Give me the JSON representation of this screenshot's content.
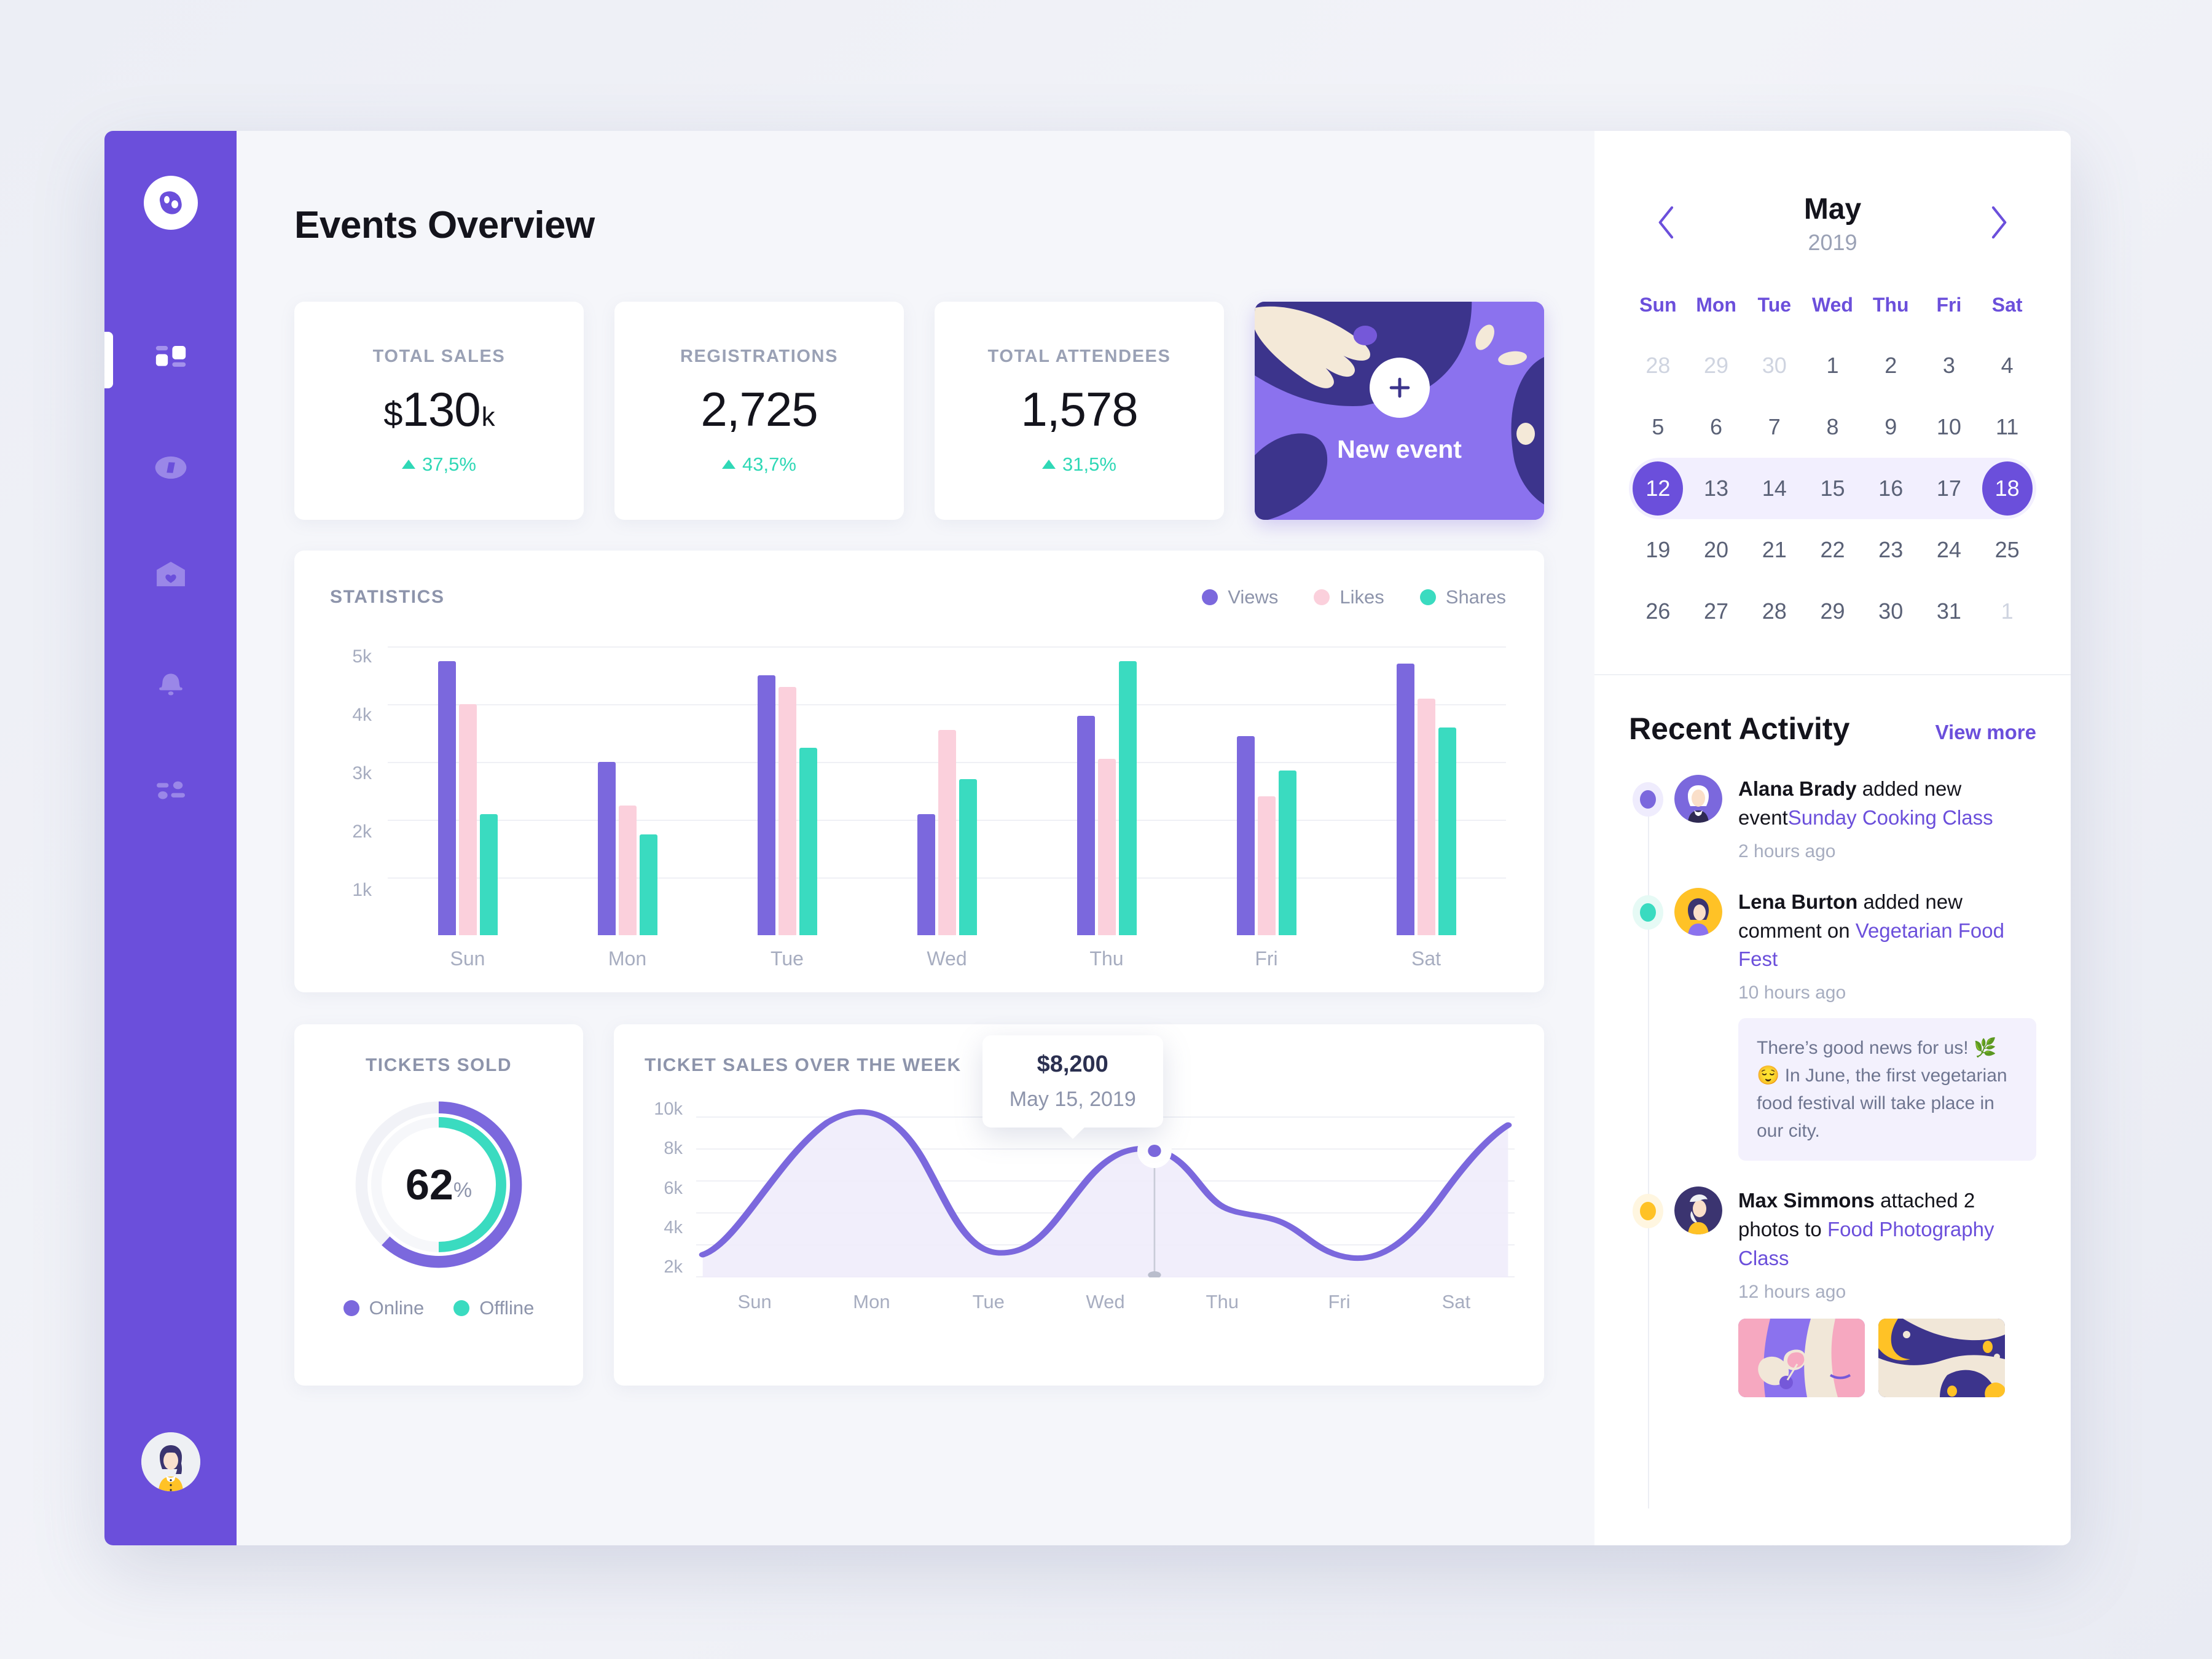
{
  "app": {
    "title": "Events Overview"
  },
  "sidebar": {
    "logo_name": "app-logo",
    "items": [
      {
        "icon": "dashboard-grid-icon",
        "active": true
      },
      {
        "icon": "compass-icon",
        "active": false
      },
      {
        "icon": "mail-heart-icon",
        "active": false
      },
      {
        "icon": "bell-icon",
        "active": false
      },
      {
        "icon": "sliders-settings-icon",
        "active": false
      }
    ],
    "avatar_name": "user-avatar"
  },
  "stats": [
    {
      "label": "TOTAL SALES",
      "currency": "$",
      "value": "130",
      "suffix": "k",
      "delta": "37,5%",
      "trend": "up"
    },
    {
      "label": "REGISTRATIONS",
      "currency": "",
      "value": "2,725",
      "suffix": "",
      "delta": "43,7%",
      "trend": "up"
    },
    {
      "label": "TOTAL ATTENDEES",
      "currency": "",
      "value": "1,578",
      "suffix": "",
      "delta": "31,5%",
      "trend": "up"
    }
  ],
  "new_event": {
    "label": "New event",
    "plus_icon": "plus-icon"
  },
  "statistics_panel": {
    "title": "STATISTICS"
  },
  "tickets_card": {
    "title": "TICKETS SOLD",
    "percent": "62",
    "percent_symbol": "%",
    "legend": [
      {
        "label": "Online",
        "color": "#7B68DD"
      },
      {
        "label": "Offline",
        "color": "#3ADBC0"
      }
    ]
  },
  "line_card": {
    "title": "TICKET SALES OVER THE WEEK",
    "tooltip": {
      "value": "$8,200",
      "date": "May 15, 2019"
    }
  },
  "calendar": {
    "month": "May",
    "year": "2019",
    "prev_icon": "chevron-left-icon",
    "next_icon": "chevron-right-icon",
    "dow": [
      "Sun",
      "Mon",
      "Tue",
      "Wed",
      "Thu",
      "Fri",
      "Sat"
    ],
    "weeks": [
      [
        {
          "d": "28",
          "m": true
        },
        {
          "d": "29",
          "m": true
        },
        {
          "d": "30",
          "m": true
        },
        {
          "d": "1"
        },
        {
          "d": "2"
        },
        {
          "d": "3"
        },
        {
          "d": "4"
        }
      ],
      [
        {
          "d": "5"
        },
        {
          "d": "6"
        },
        {
          "d": "7"
        },
        {
          "d": "8"
        },
        {
          "d": "9"
        },
        {
          "d": "10"
        },
        {
          "d": "11"
        }
      ],
      [
        {
          "d": "12",
          "sel": true,
          "rs": true
        },
        {
          "d": "13",
          "ir": true
        },
        {
          "d": "14",
          "ir": true
        },
        {
          "d": "15",
          "ir": true
        },
        {
          "d": "16",
          "ir": true
        },
        {
          "d": "17",
          "ir": true
        },
        {
          "d": "18",
          "sel": true,
          "re": true
        }
      ],
      [
        {
          "d": "19"
        },
        {
          "d": "20"
        },
        {
          "d": "21"
        },
        {
          "d": "22"
        },
        {
          "d": "23"
        },
        {
          "d": "24"
        },
        {
          "d": "25"
        }
      ],
      [
        {
          "d": "26"
        },
        {
          "d": "27"
        },
        {
          "d": "28"
        },
        {
          "d": "29"
        },
        {
          "d": "30"
        },
        {
          "d": "31"
        },
        {
          "d": "1",
          "m": true
        }
      ]
    ]
  },
  "recent_activity": {
    "title": "Recent Activity",
    "view_more": "View more",
    "items": [
      {
        "dot_color": "#7B68DD",
        "dot_bg": "#efecfd",
        "avatar": "avatar-alana-brady",
        "name": "Alana Brady",
        "action": " added new event",
        "link": "Sunday Cooking Class",
        "time": "2 hours ago"
      },
      {
        "dot_color": "#3ADBC0",
        "dot_bg": "#e6faf5",
        "avatar": "avatar-lena-burton",
        "name": "Lena Burton",
        "action": " added new comment on ",
        "link": "Vegetarian Food Fest",
        "time": "10 hours ago",
        "bubble": "There’s good news for us! 🌿😌 In June, the first vegetarian food festival will take place in our city."
      },
      {
        "dot_color": "#FFC226",
        "dot_bg": "#fff6e0",
        "avatar": "avatar-max-simmons",
        "name": "Max Simmons",
        "action": " attached 2 photos to ",
        "link": "Food Photography Class",
        "time": "12 hours ago",
        "photos": [
          "photo-wine-glass",
          "photo-abstract-navy"
        ]
      }
    ]
  },
  "chart_data": [
    {
      "type": "bar",
      "title": "STATISTICS",
      "categories": [
        "Sun",
        "Mon",
        "Tue",
        "Wed",
        "Thu",
        "Fri",
        "Sat"
      ],
      "series": [
        {
          "name": "Views",
          "color": "#7B68DD",
          "values": [
            4750,
            3000,
            4500,
            2100,
            3800,
            3450,
            4700
          ]
        },
        {
          "name": "Likes",
          "color": "#FBD0DC",
          "values": [
            4000,
            2250,
            4300,
            3550,
            3050,
            2400,
            4100
          ]
        },
        {
          "name": "Shares",
          "color": "#3ADBC0",
          "values": [
            2100,
            1750,
            3250,
            2700,
            4750,
            2850,
            3600
          ]
        }
      ],
      "ylim": [
        0,
        5000
      ],
      "yticks": [
        "1k",
        "2k",
        "3k",
        "4k",
        "5k"
      ],
      "xlabel": "",
      "ylabel": "",
      "grid": true,
      "legend_position": "top-right"
    },
    {
      "type": "pie",
      "title": "TICKETS SOLD",
      "labels": [
        "Online",
        "Offline"
      ],
      "values": [
        62,
        48
      ],
      "colors": [
        "#7B68DD",
        "#3ADBC0"
      ],
      "center_label": "62%"
    },
    {
      "type": "area",
      "title": "TICKET SALES OVER THE WEEK",
      "x": [
        "Sun",
        "Mon",
        "Tue",
        "Wed",
        "Thu",
        "Fri",
        "Sat"
      ],
      "values": [
        1400,
        9900,
        2050,
        7700,
        4650,
        1500,
        9400
      ],
      "highlight": {
        "x": "Wed",
        "value": 8200,
        "label": "$8,200",
        "date": "May 15, 2019"
      },
      "ylim": [
        0,
        11000
      ],
      "yticks": [
        "2k",
        "4k",
        "6k",
        "8k",
        "10k"
      ],
      "color": "#7B68DD",
      "grid": true
    }
  ],
  "colors": {
    "brand_purple": "#6B4FDB",
    "bar_views": "#7B68DD",
    "bar_likes": "#FBD0DC",
    "bar_shares": "#3ADBC0",
    "positive": "#2fd8b6"
  }
}
